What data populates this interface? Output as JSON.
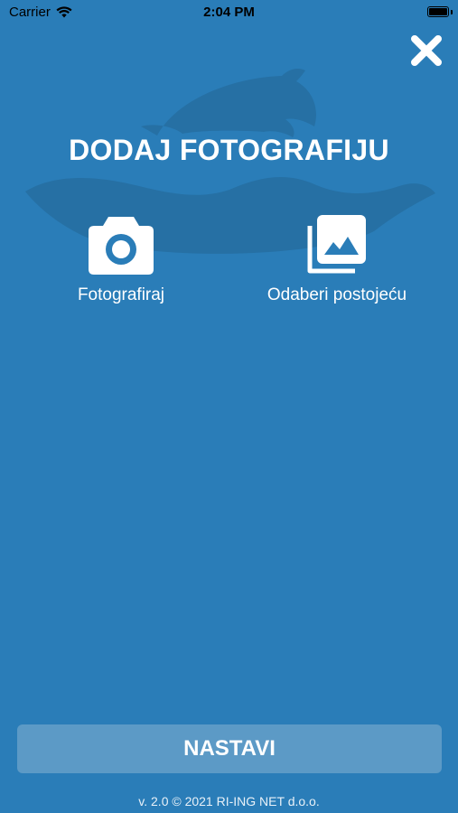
{
  "status_bar": {
    "carrier": "Carrier",
    "time": "2:04 PM"
  },
  "header": {
    "close_icon": "close-icon"
  },
  "main": {
    "title": "DODAJ FOTOGRAFIJU",
    "options": [
      {
        "label": "Fotografiraj",
        "icon": "camera-icon"
      },
      {
        "label": "Odaberi postojeću",
        "icon": "gallery-icon"
      }
    ]
  },
  "footer": {
    "continue_label": "NASTAVI",
    "version": "v. 2.0 © 2021 RI-ING NET d.o.o."
  },
  "colors": {
    "background": "#2a7db8",
    "button_bg": "#5c9ac6",
    "logo_shape": "#2670a4",
    "text": "#ffffff"
  }
}
